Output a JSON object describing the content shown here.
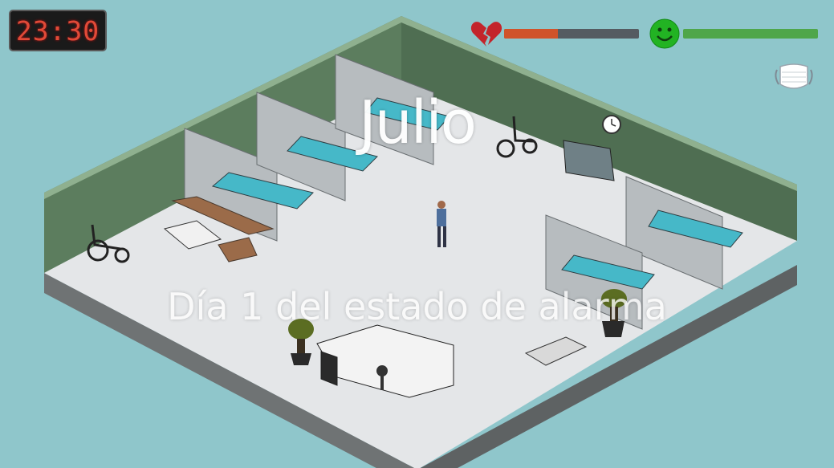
{
  "hud": {
    "clock_time": "23:30",
    "health_level": 0.4,
    "mood_level": 1.0,
    "health_icon": "broken-heart-icon",
    "mood_icon": "smiley-face-icon",
    "mask_icon": "face-mask-icon"
  },
  "overlay": {
    "name": "Julio",
    "subtitle": "Día 1 del estado de alarma"
  },
  "colors": {
    "background": "#8fc6cb",
    "floor": "#e4e6e8",
    "wall": "#5c7d5e",
    "clock_digits": "#e14a38",
    "health_fill": "#d0532a",
    "mood_fill": "#4fa64a"
  }
}
